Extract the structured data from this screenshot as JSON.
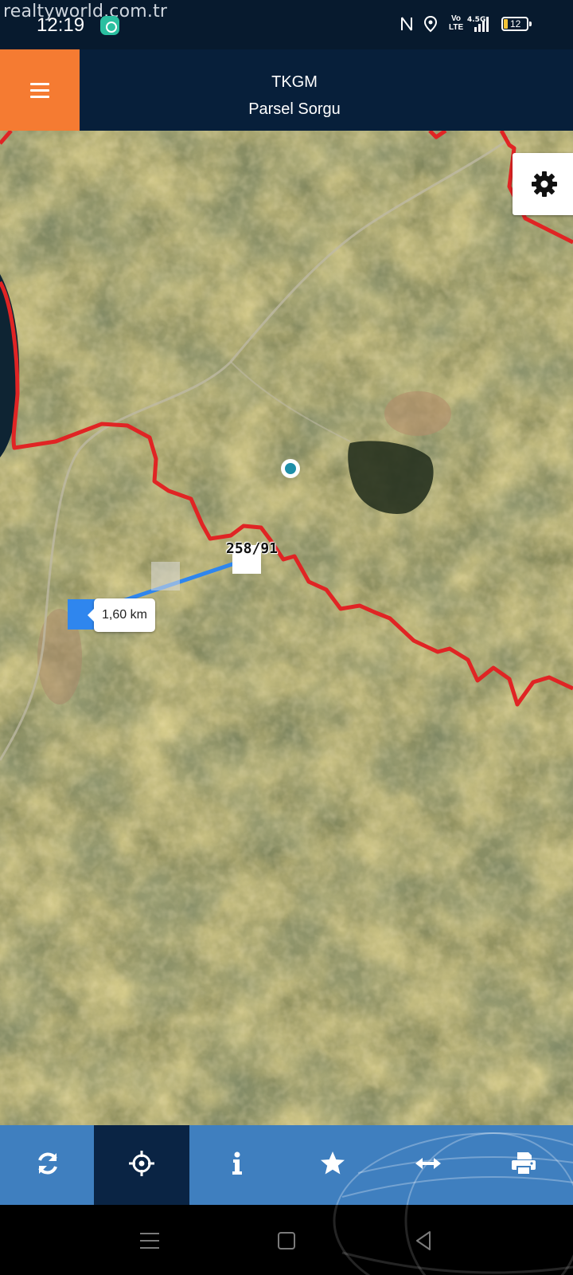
{
  "status_bar": {
    "watermark": "realtyworld.com.tr",
    "time": "12:19",
    "network": "4.5G",
    "volte": "Vo LTE",
    "battery": "12",
    "icons": [
      "notification-app-icon",
      "nfc-icon",
      "location-icon",
      "signal-icon",
      "battery-icon"
    ]
  },
  "header": {
    "menu_icon": "hamburger-menu-icon",
    "title": "TKGM",
    "subtitle": "Parsel Sorgu",
    "colors": {
      "header_bg": "#071f3a",
      "menu_bg": "#f57b32"
    }
  },
  "map": {
    "settings_icon": "gear-icon",
    "parcel_label": "258/91",
    "measure_distance": "1,60 km",
    "colors": {
      "boundary": "#e02424",
      "measure_line": "#2f86ee",
      "location": "#1f8fa8"
    }
  },
  "toolbar": {
    "items": [
      {
        "icon": "refresh-icon",
        "active": false
      },
      {
        "icon": "locate-crosshair-icon",
        "active": true
      },
      {
        "icon": "info-icon",
        "active": false
      },
      {
        "icon": "star-icon",
        "active": false
      },
      {
        "icon": "measure-arrows-icon",
        "active": false
      },
      {
        "icon": "print-icon",
        "active": false
      }
    ],
    "colors": {
      "bg": "#3f7fbf",
      "active_bg": "#0a2444"
    }
  },
  "navigation_bar": {
    "buttons": [
      "recent-apps-icon",
      "home-icon",
      "back-icon"
    ]
  }
}
